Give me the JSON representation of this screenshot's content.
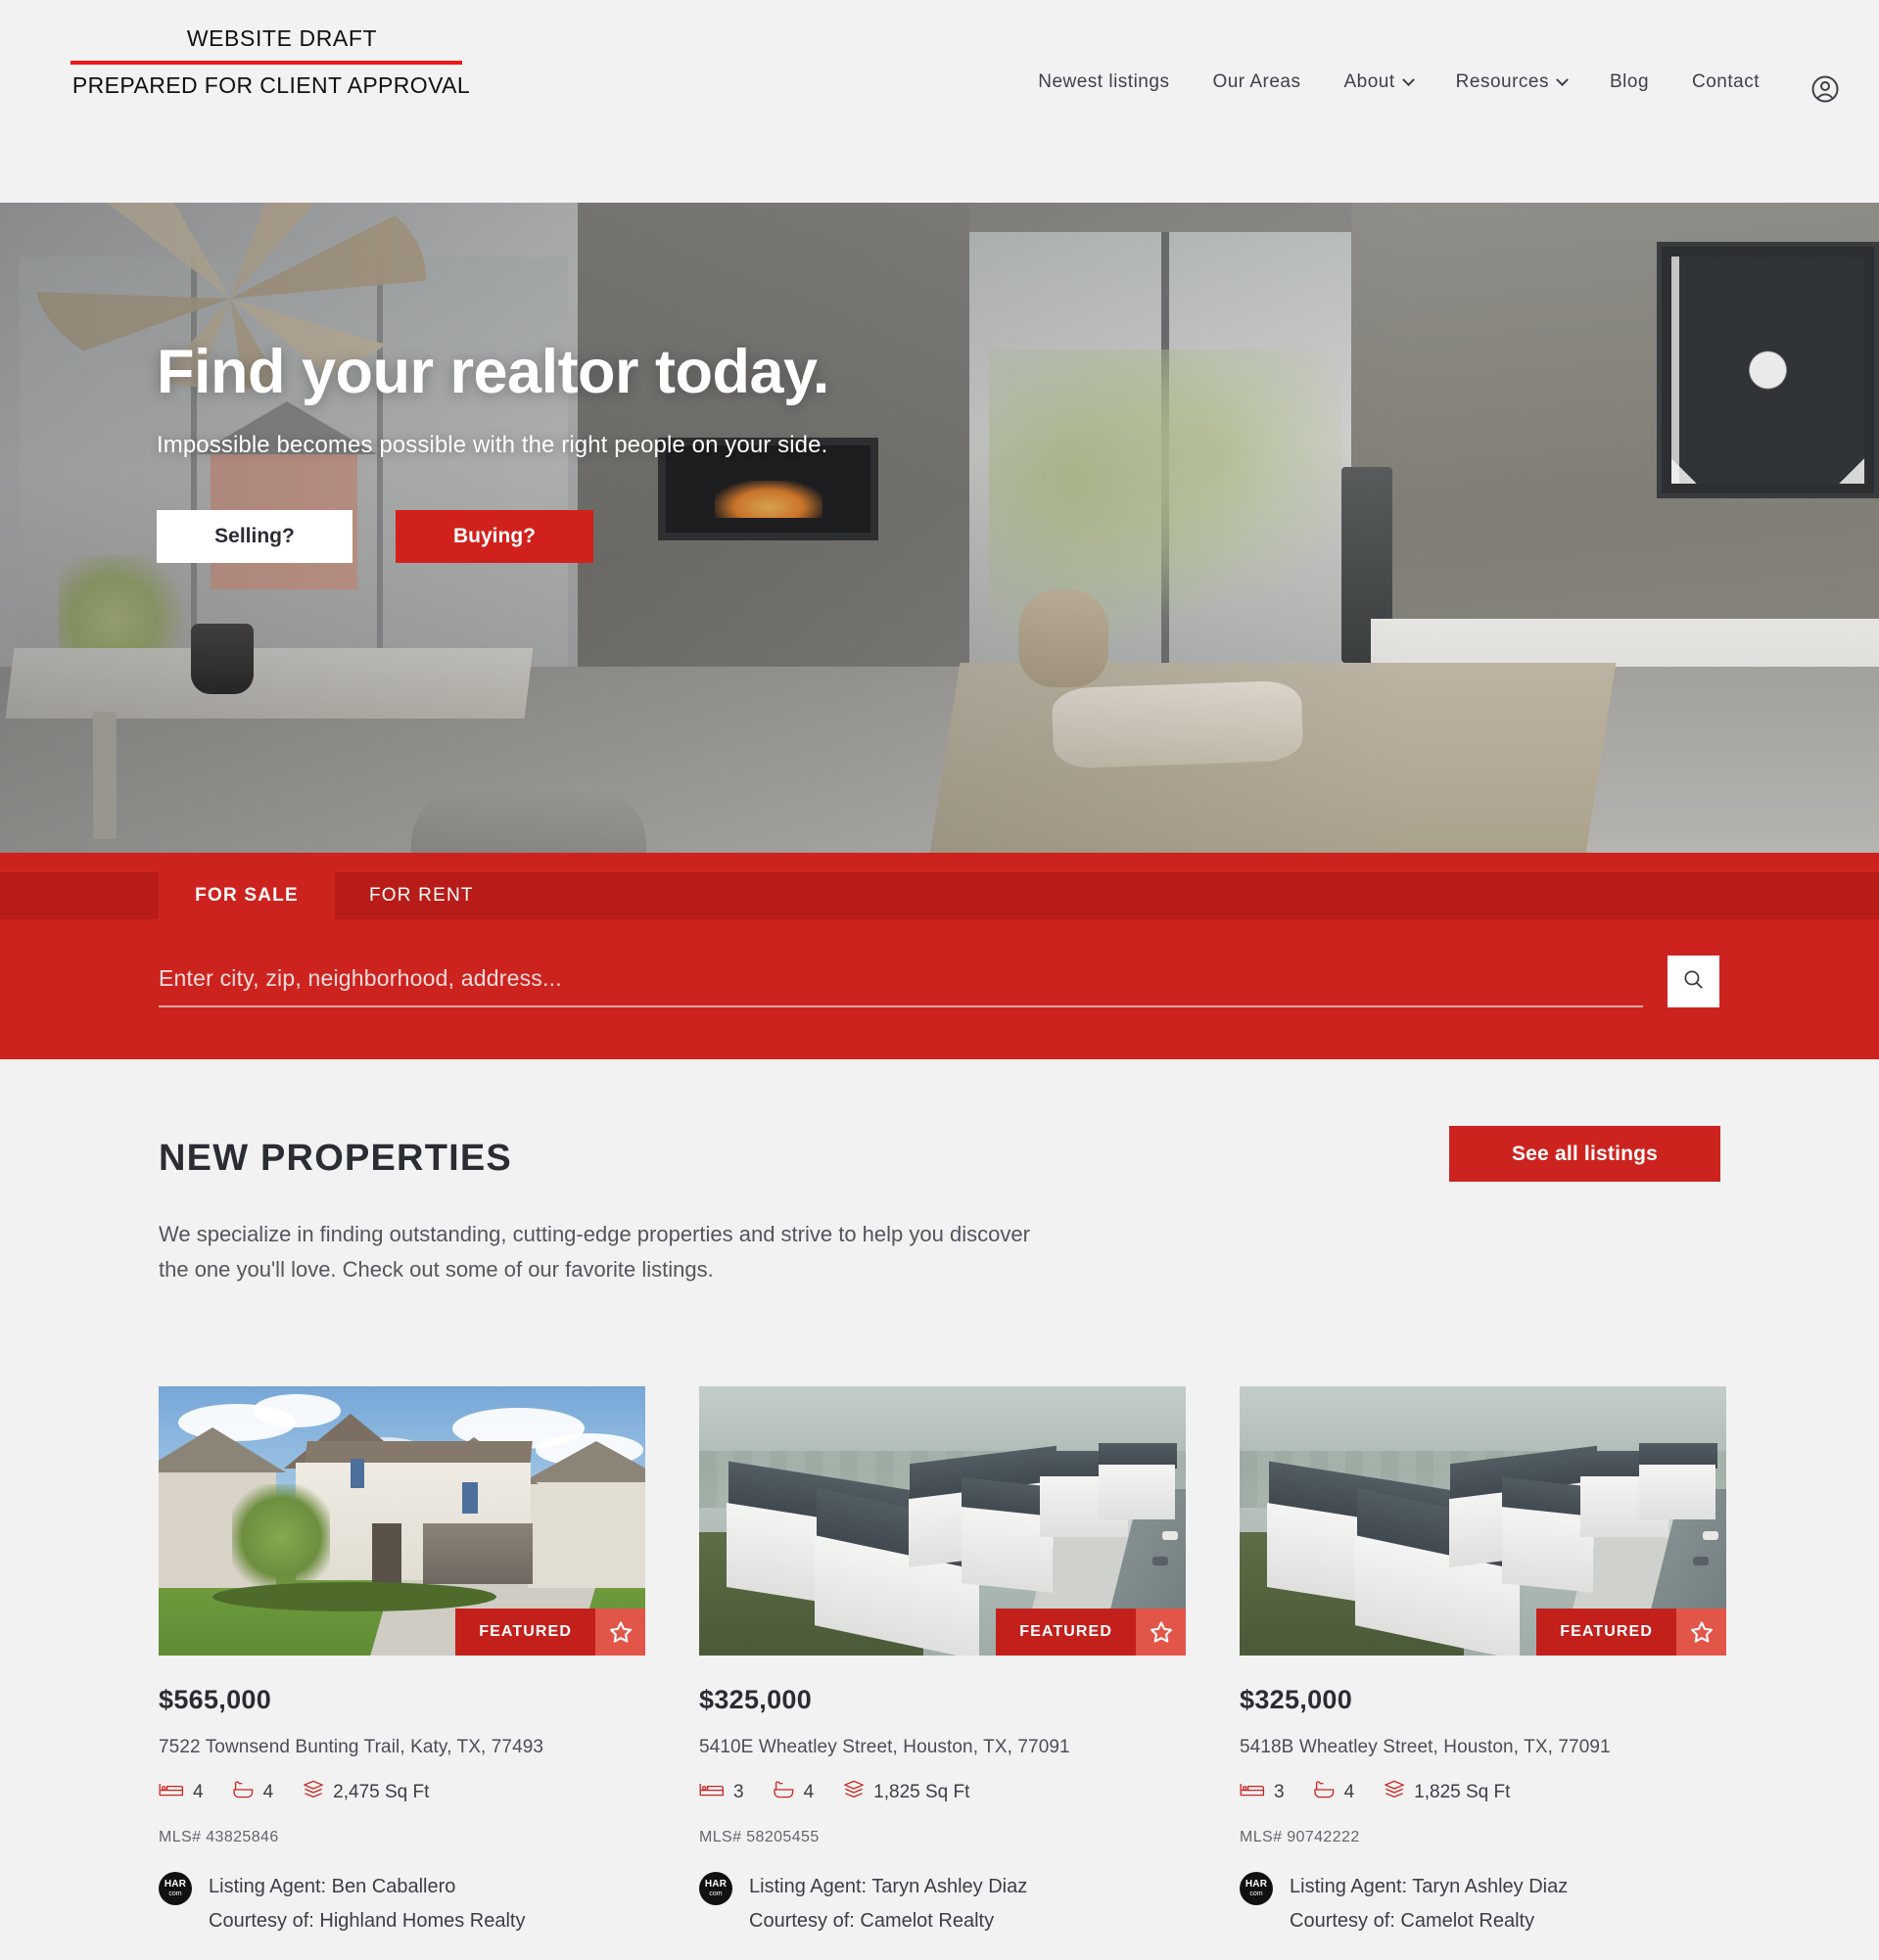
{
  "brand": {
    "logo_line1": "WEBSITE DRAFT",
    "logo_line2": "PREPARED FOR CLIENT APPROVAL",
    "accent_red": "#cd231f",
    "rule_red": "#ef1616"
  },
  "nav": {
    "items": [
      {
        "label": "Newest listings",
        "has_caret": false
      },
      {
        "label": "Our Areas",
        "has_caret": false
      },
      {
        "label": "About",
        "has_caret": true
      },
      {
        "label": "Resources",
        "has_caret": true
      },
      {
        "label": "Blog",
        "has_caret": false
      },
      {
        "label": "Contact",
        "has_caret": false
      }
    ],
    "account_icon": "user-circle-icon"
  },
  "hero": {
    "title": "Find your realtor today.",
    "subtitle": "Impossible becomes possible with the right people on your side.",
    "button_selling": "Selling?",
    "button_buying": "Buying?"
  },
  "search": {
    "tab_for_sale": "FOR SALE",
    "tab_for_rent": "FOR RENT",
    "active_tab": "FOR SALE",
    "placeholder": "Enter city, zip, neighborhood, address...",
    "value": "",
    "search_icon": "magnifier-icon"
  },
  "properties_section": {
    "title": "NEW PROPERTIES",
    "description": "We specialize in finding outstanding, cutting-edge properties and strive to help you discover the one you'll love. Check out some of our favorite listings.",
    "see_all_label": "See all listings",
    "featured_label": "FEATURED",
    "agent_prefix": "Listing Agent:",
    "courtesy_prefix": "Courtesy of:",
    "har_badge_top": "HAR",
    "har_badge_bottom": "com"
  },
  "listings": [
    {
      "price": "$565,000",
      "address": "7522 Townsend Bunting Trail, Katy, TX, 77493",
      "beds": "4",
      "baths": "4",
      "sqft": "2,475 Sq Ft",
      "mls": "MLS# 43825846",
      "agent": "Listing Agent: Ben Caballero",
      "courtesy": "Courtesy of: Highland Homes Realty",
      "featured": "FEATURED",
      "photo_type": "house-exterior"
    },
    {
      "price": "$325,000",
      "address": "5410E Wheatley Street, Houston, TX, 77091",
      "beds": "3",
      "baths": "4",
      "sqft": "1,825 Sq Ft",
      "mls": "MLS# 58205455",
      "agent": "Listing Agent: Taryn Ashley Diaz",
      "courtesy": "Courtesy of: Camelot Realty",
      "featured": "FEATURED",
      "photo_type": "aerial-townhomes"
    },
    {
      "price": "$325,000",
      "address": "5418B Wheatley Street, Houston, TX, 77091",
      "beds": "3",
      "baths": "4",
      "sqft": "1,825 Sq Ft",
      "mls": "MLS# 90742222",
      "agent": "Listing Agent: Taryn Ashley Diaz",
      "courtesy": "Courtesy of: Camelot Realty",
      "featured": "FEATURED",
      "photo_type": "aerial-townhomes"
    }
  ]
}
